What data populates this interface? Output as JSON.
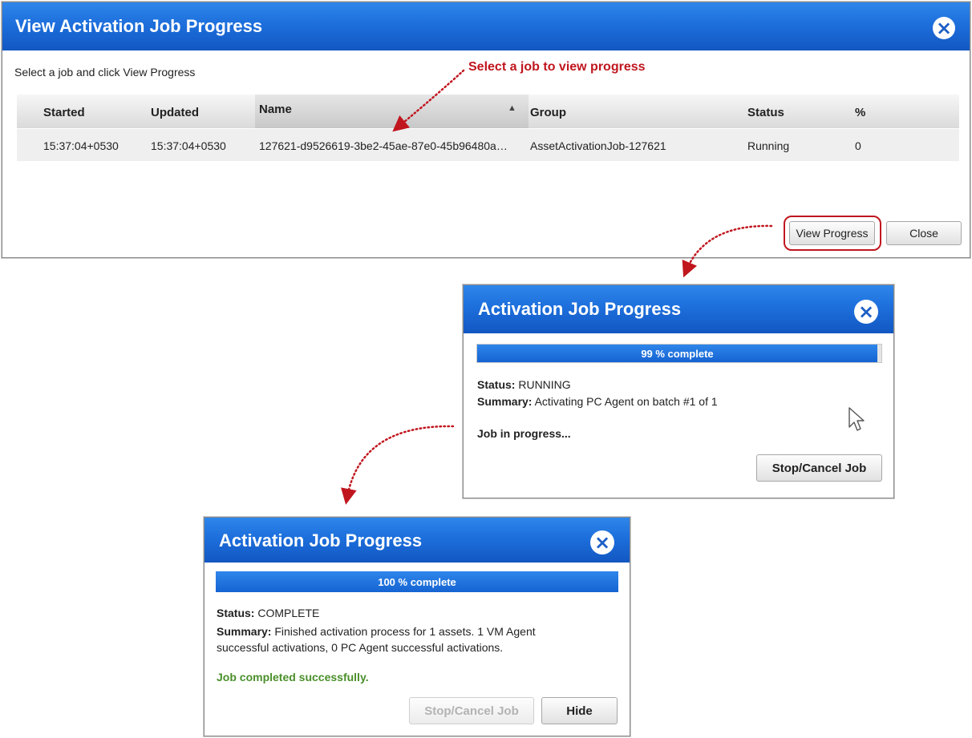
{
  "main_dialog": {
    "title": "View Activation Job Progress",
    "close_icon": "×",
    "instruction": "Select a job and click View Progress",
    "callout": "Select a job to view progress",
    "columns": [
      "Started",
      "Updated",
      "Name",
      "Group",
      "Status",
      "%"
    ],
    "sort_icon": "▲",
    "row": {
      "started": "15:37:04+0530",
      "updated": "15:37:04+0530",
      "name": "127621-d9526619-3be2-45ae-87e0-45b96480a…",
      "group": "AssetActivationJob-127621",
      "status": "Running",
      "percent": "0"
    },
    "view_progress_label": "View Progress",
    "close_label": "Close"
  },
  "progress_running": {
    "title": "Activation Job Progress",
    "close_icon": "×",
    "progress_text": "99 % complete",
    "progress_fraction": 0.99,
    "status_label": "Status:",
    "status_value": "RUNNING",
    "summary_label": "Summary:",
    "summary_value": "Activating PC Agent on batch #1 of 1",
    "message": "Job in progress...",
    "stop_label": "Stop/Cancel Job",
    "cursor_icon": "pointer-cursor-icon"
  },
  "progress_complete": {
    "title": "Activation Job Progress",
    "close_icon": "×",
    "progress_text": "100 % complete",
    "progress_fraction": 1.0,
    "status_label": "Status:",
    "status_value": "COMPLETE",
    "summary_label": "Summary:",
    "summary_line1": "Finished activation process for 1 assets. 1 VM Agent",
    "summary_line2": "successful activations, 0 PC Agent successful activations.",
    "message": "Job completed successfully.",
    "stop_label": "Stop/Cancel Job",
    "hide_label": "Hide"
  },
  "colors": {
    "title_bar": "#1d6fdc",
    "callout_red": "#c0161e",
    "success_green": "#4a8f2a"
  }
}
